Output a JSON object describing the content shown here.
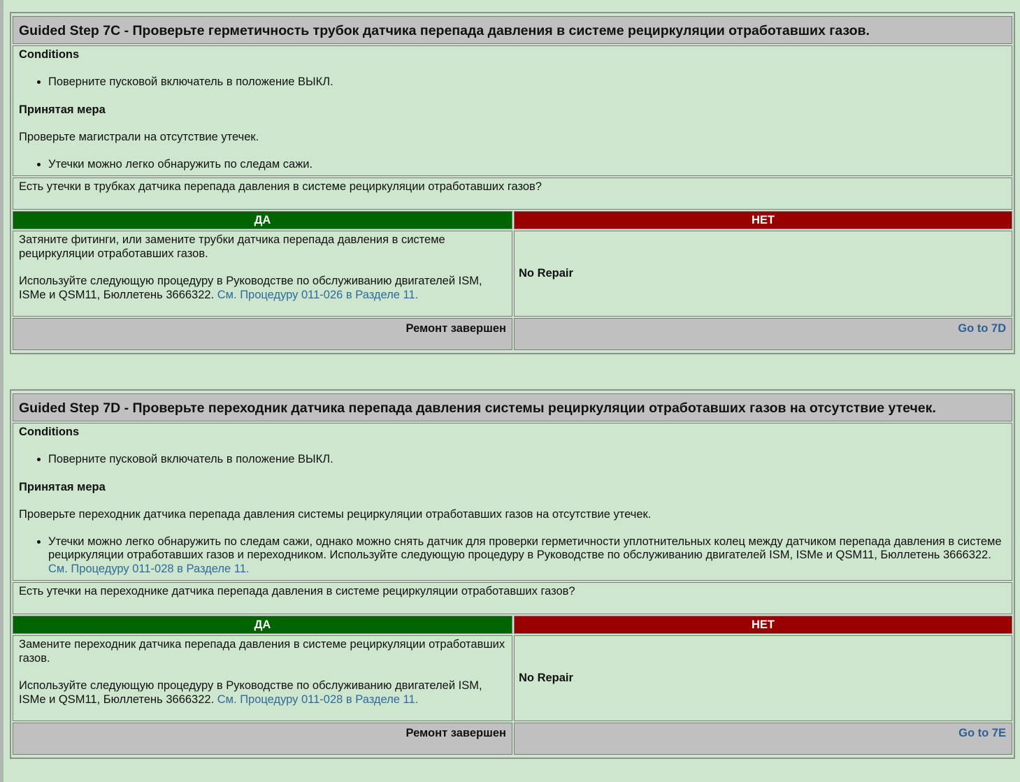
{
  "steps": [
    {
      "title": "Guided Step 7C - Проверьте герметичность трубок датчика перепада давления в системе рециркуляции отработавших газов.",
      "conditions_label": "Conditions",
      "conditions": [
        "Поверните пусковой включатель в положение ВЫКЛ."
      ],
      "action_label": "Принятая мера",
      "action_text": "Проверьте магистрали на отсутствие утечек.",
      "action_bullets": [
        {
          "text": "Утечки можно легко обнаружить по следам сажи.",
          "link": ""
        }
      ],
      "question": "Есть утечки в трубках датчика перепада давления в системе рециркуляции отработавших газов?",
      "yes_label": "ДА",
      "no_label": "НЕТ",
      "yes_text_1": "Затяните фитинги, или замените трубки датчика перепада давления в системе рециркуляции отработавших газов.",
      "yes_text_2": "Используйте следующую процедуру в Руководстве по обслуживанию двигателей ISM, ISMe и QSM11, Бюллетень 3666322.",
      "yes_link": "См. Процедуру 011-026 в Разделе 11.",
      "no_text": "No Repair",
      "yes_footer": "Ремонт завершен",
      "no_footer": "Go to 7D"
    },
    {
      "title": "Guided Step 7D - Проверьте переходник датчика перепада давления системы рециркуляции отработавших газов на отсутствие утечек.",
      "conditions_label": "Conditions",
      "conditions": [
        "Поверните пусковой включатель в положение ВЫКЛ."
      ],
      "action_label": "Принятая мера",
      "action_text": "Проверьте переходник датчика перепада давления системы рециркуляции отработавших газов на отсутствие утечек.",
      "action_bullets": [
        {
          "text": "Утечки можно легко обнаружить по следам сажи, однако можно снять датчик для проверки герметичности уплотнительных колец между датчиком перепада давления в системе рециркуляции отработавших газов и переходником. Используйте следующую процедуру в Руководстве по обслуживанию двигателей ISM, ISMe и QSM11, Бюллетень 3666322.",
          "link": "См. Процедуру 011-028 в Разделе 11."
        }
      ],
      "question": "Есть утечки на переходнике датчика перепада давления в системе рециркуляции отработавших газов?",
      "yes_label": "ДА",
      "no_label": "НЕТ",
      "yes_text_1": "Замените переходник датчика перепада давления в системе рециркуляции отработавших газов.",
      "yes_text_2": "Используйте следующую процедуру в Руководстве по обслуживанию двигателей ISM, ISMe и QSM11, Бюллетень 3666322.",
      "yes_link": "См. Процедуру 011-028 в Разделе 11.",
      "no_text": "No Repair",
      "yes_footer": "Ремонт завершен",
      "no_footer": "Go to 7E"
    }
  ]
}
